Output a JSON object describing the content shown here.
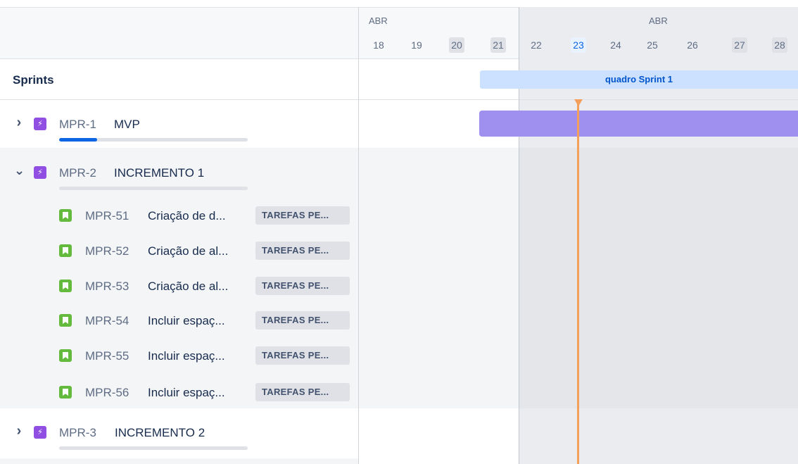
{
  "timeline": {
    "months": [
      {
        "label": "ABR"
      },
      {
        "label": "ABR"
      }
    ],
    "days": [
      {
        "label": "18",
        "weekend": false,
        "today": false
      },
      {
        "label": "19",
        "weekend": false,
        "today": false
      },
      {
        "label": "20",
        "weekend": true,
        "today": false
      },
      {
        "label": "21",
        "weekend": true,
        "today": false
      },
      {
        "label": "22",
        "weekend": false,
        "today": false
      },
      {
        "label": "23",
        "weekend": false,
        "today": true
      },
      {
        "label": "24",
        "weekend": false,
        "today": false
      },
      {
        "label": "25",
        "weekend": false,
        "today": false
      },
      {
        "label": "26",
        "weekend": false,
        "today": false
      },
      {
        "label": "27",
        "weekend": true,
        "today": false
      },
      {
        "label": "28",
        "weekend": true,
        "today": false
      }
    ],
    "sprints_label": "Sprints",
    "sprint_bar_label": "quadro Sprint 1"
  },
  "epics": [
    {
      "key": "MPR-1",
      "summary": "MVP",
      "expanded": false,
      "progress": 0.2
    },
    {
      "key": "MPR-2",
      "summary": "INCREMENTO 1",
      "expanded": true,
      "progress": 0
    },
    {
      "key": "MPR-3",
      "summary": "INCREMENTO 2",
      "expanded": false,
      "progress": 0
    }
  ],
  "stories": [
    {
      "key": "MPR-51",
      "summary": "Criação de d...",
      "status": "TAREFAS PE..."
    },
    {
      "key": "MPR-52",
      "summary": "Criação de al...",
      "status": "TAREFAS PE..."
    },
    {
      "key": "MPR-53",
      "summary": "Criação de al...",
      "status": "TAREFAS PE..."
    },
    {
      "key": "MPR-54",
      "summary": "Incluir espaç...",
      "status": "TAREFAS PE..."
    },
    {
      "key": "MPR-55",
      "summary": "Incluir espaç...",
      "status": "TAREFAS PE..."
    },
    {
      "key": "MPR-56",
      "summary": "Incluir espaç...",
      "status": "TAREFAS PE..."
    }
  ],
  "icons": {
    "collapsed": "chevron-right-icon",
    "expanded": "chevron-down-icon",
    "epic": "epic-lightning-icon",
    "story": "story-bookmark-icon"
  },
  "colors": {
    "epic_icon": "#904ee2",
    "story_icon": "#63ba3c",
    "epic_bar": "#9f8fef",
    "sprint_bar": "#cce0ff",
    "today_line": "#f5a05a",
    "progress": "#0c66e4"
  }
}
